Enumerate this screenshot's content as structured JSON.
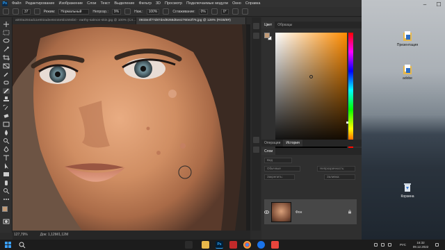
{
  "app": {
    "menu": [
      "Файл",
      "Редактирование",
      "Изображение",
      "Слои",
      "Текст",
      "Выделение",
      "Фильтр",
      "3D",
      "Просмотр",
      "Подключаемые модули",
      "Окно",
      "Справка"
    ]
  },
  "options_bar": {
    "brush_size": "37",
    "mode_label": "Режим:",
    "mode_value": "Нормальный",
    "opacity_label": "Непрозр.:",
    "opacity_value": "9%",
    "flow_label": "Наж.:",
    "flow_value": "100%",
    "smoothing_label": "Сглаживание:",
    "smoothing_value": "0%",
    "angle_value": "0°"
  },
  "tabs": [
    {
      "label": "a000a284ad11e802adee8444e5b1594b0 - earthy-salmon-skin.jpg @ 100% (Сл..."
    },
    {
      "label": "0933e4f77d87ded9268d5ee2760e2f76.jpg @ 128% (RGB/8#)"
    }
  ],
  "status": {
    "zoom": "127,79%",
    "doc": "Док: 1,12M/1,12M"
  },
  "color_panel": {
    "tabs": [
      "Цвет",
      "Образцы"
    ],
    "fg_color": "#c29a76",
    "hue_color": "#ff8c00"
  },
  "layers_panel": {
    "tab_labels": [
      "Операции",
      "История"
    ],
    "section": "Слои",
    "search_placeholder": "Вид",
    "blend_mode": "Обычные",
    "opacity_label": "Непрозрачность:",
    "lock_label": "Закрепить:",
    "fill_label": "Заливка:",
    "layer_name": "Фон"
  },
  "desktop": {
    "icons": [
      {
        "label": "Презентация",
        "icon": "folder-document-icon"
      },
      {
        "label": "adobe",
        "icon": "folder-document-icon"
      },
      {
        "label": "Корзина",
        "icon": "recycle-bin-icon"
      }
    ]
  },
  "taskbar": {
    "lang": "РУС",
    "time": "16:32",
    "date": "09.12.2022"
  }
}
